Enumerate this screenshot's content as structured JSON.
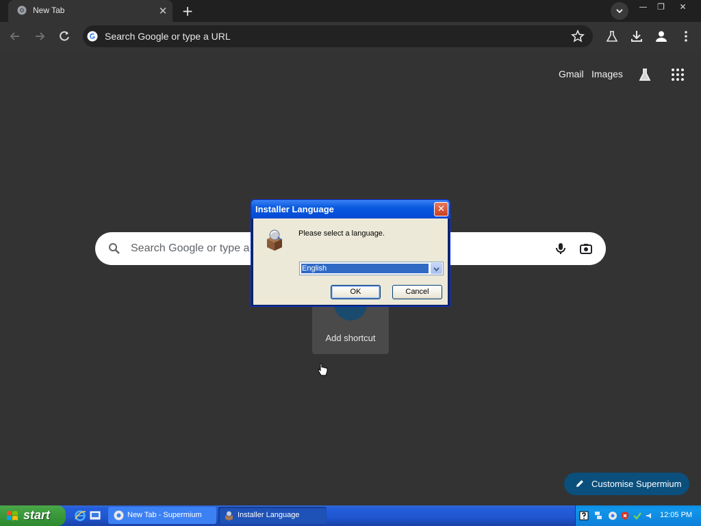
{
  "browser": {
    "tab": {
      "title": "New Tab",
      "close_glyph": "✕"
    },
    "new_tab_glyph": "+",
    "window_controls": {
      "minimize": "—",
      "restore": "❐",
      "close": "✕"
    },
    "omnibox": {
      "placeholder": "Search Google or type a URL"
    }
  },
  "ntp": {
    "links": {
      "gmail": "Gmail",
      "images": "Images"
    },
    "search": {
      "placeholder": "Search Google or type a"
    },
    "shortcut": {
      "label": "Add shortcut",
      "glyph": "+"
    },
    "customise_button": {
      "label": "Customise Supermium"
    }
  },
  "dialog": {
    "title": "Installer Language",
    "close_glyph": "✕",
    "prompt": "Please select a language.",
    "language_select": {
      "value": "English"
    },
    "ok_label": "OK",
    "cancel_label": "Cancel"
  },
  "taskbar": {
    "start_label": "start",
    "tasks": [
      {
        "label": "New Tab - Supermium",
        "active": false
      },
      {
        "label": "Installer Language",
        "active": true
      }
    ],
    "clock": "12:05 PM"
  },
  "colors": {
    "page_bg": "#333333",
    "xp_title_blue": "#0a5ae0",
    "taskbar_blue": "#245edb",
    "start_green": "#3c9a3c",
    "customise_blue": "#0b4f7c"
  },
  "icons": {
    "toolbar": [
      "back-arrow-icon",
      "forward-arrow-icon",
      "reload-icon",
      "bookmark-star-icon",
      "labs-flask-icon",
      "download-icon",
      "profile-icon",
      "menu-dots-icon"
    ],
    "ntp": [
      "labs-flask-icon",
      "apps-grid-icon",
      "search-icon",
      "microphone-icon",
      "camera-lens-icon",
      "pencil-icon"
    ],
    "tray": [
      "help-icon",
      "network-icon",
      "supermium-icon",
      "security-shield-icon",
      "update-icon",
      "volume-icon"
    ]
  }
}
